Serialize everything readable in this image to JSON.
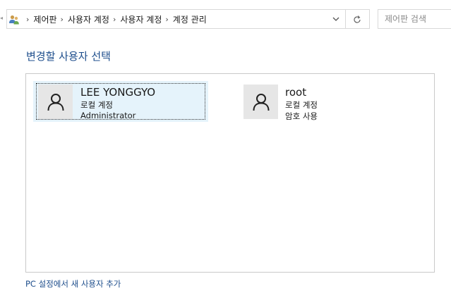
{
  "breadcrumb": {
    "items": [
      "제어판",
      "사용자 계정",
      "사용자 계정",
      "계정 관리"
    ]
  },
  "search": {
    "placeholder": "제어판 검색"
  },
  "page_title": "변경할 사용자 선택",
  "accounts": [
    {
      "name": "LEE YONGGYO",
      "type": "로컬 계정",
      "detail": "Administrator",
      "selected": true
    },
    {
      "name": "root",
      "type": "로컬 계정",
      "detail": "암호 사용",
      "selected": false
    }
  ],
  "add_user_link": "PC 설정에서 새 사용자 추가",
  "colors": {
    "accent_blue": "#1e4e8c",
    "selection_bg": "#e5f3fb",
    "avatar_bg": "#e6e6e6"
  },
  "icons": {
    "addr_icon": "user-accounts-icon",
    "dropdown": "chevron-down-icon",
    "refresh": "refresh-icon",
    "avatar": "user-icon"
  }
}
